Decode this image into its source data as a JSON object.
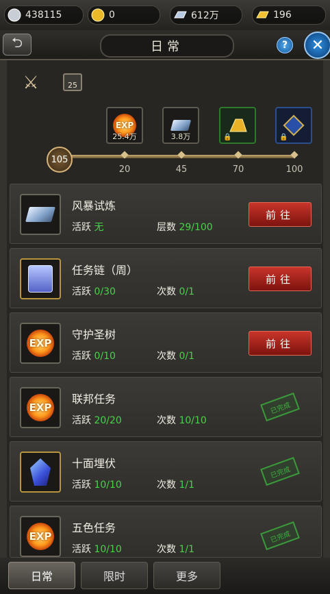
{
  "topbar": {
    "silver": "438115",
    "gold": "0",
    "ingot": "612万",
    "yuanbao": "196"
  },
  "header": {
    "title": "日常"
  },
  "rewards": [
    {
      "amount": "25.4万",
      "icon": "exp-orb-icon",
      "locked": false
    },
    {
      "amount": "3.8万",
      "icon": "silver-ingot-icon",
      "locked": false
    },
    {
      "amount": "",
      "icon": "gold-ingot-icon",
      "locked": true
    },
    {
      "amount": "",
      "icon": "blue-medal-icon",
      "locked": true
    }
  ],
  "progress": {
    "level": "105",
    "milestones": [
      "20",
      "45",
      "70",
      "100"
    ]
  },
  "calendar": {
    "day": "25"
  },
  "tasks": [
    {
      "name": "风暴试炼",
      "active_label": "活跃",
      "active_value": "无",
      "count_label": "层数",
      "count_value": "29/100",
      "button": "前往",
      "icon": "silver-ingot-icon"
    },
    {
      "name": "任务链（周）",
      "active_label": "活跃",
      "active_value": "0/30",
      "count_label": "次数",
      "count_value": "0/1",
      "button": "前往",
      "icon": "scroll-icon"
    },
    {
      "name": "守护圣树",
      "active_label": "活跃",
      "active_value": "0/10",
      "count_label": "次数",
      "count_value": "0/1",
      "button": "前往",
      "icon": "exp-orb-icon"
    },
    {
      "name": "联邦任务",
      "active_label": "活跃",
      "active_value": "20/20",
      "count_label": "次数",
      "count_value": "10/10",
      "stamp": "已完成",
      "icon": "exp-orb-icon"
    },
    {
      "name": "十面埋伏",
      "active_label": "活跃",
      "active_value": "10/10",
      "count_label": "次数",
      "count_value": "1/1",
      "stamp": "已完成",
      "icon": "blue-crystal-icon"
    },
    {
      "name": "五色任务",
      "active_label": "活跃",
      "active_value": "10/10",
      "count_label": "次数",
      "count_value": "1/1",
      "stamp": "已完成",
      "icon": "exp-orb-icon"
    }
  ],
  "tabs": [
    "日常",
    "限时",
    "更多"
  ],
  "colors": {
    "accent_green": "#4ad24a",
    "button_red": "#b32a20",
    "stamp_green": "#3fae3f"
  }
}
